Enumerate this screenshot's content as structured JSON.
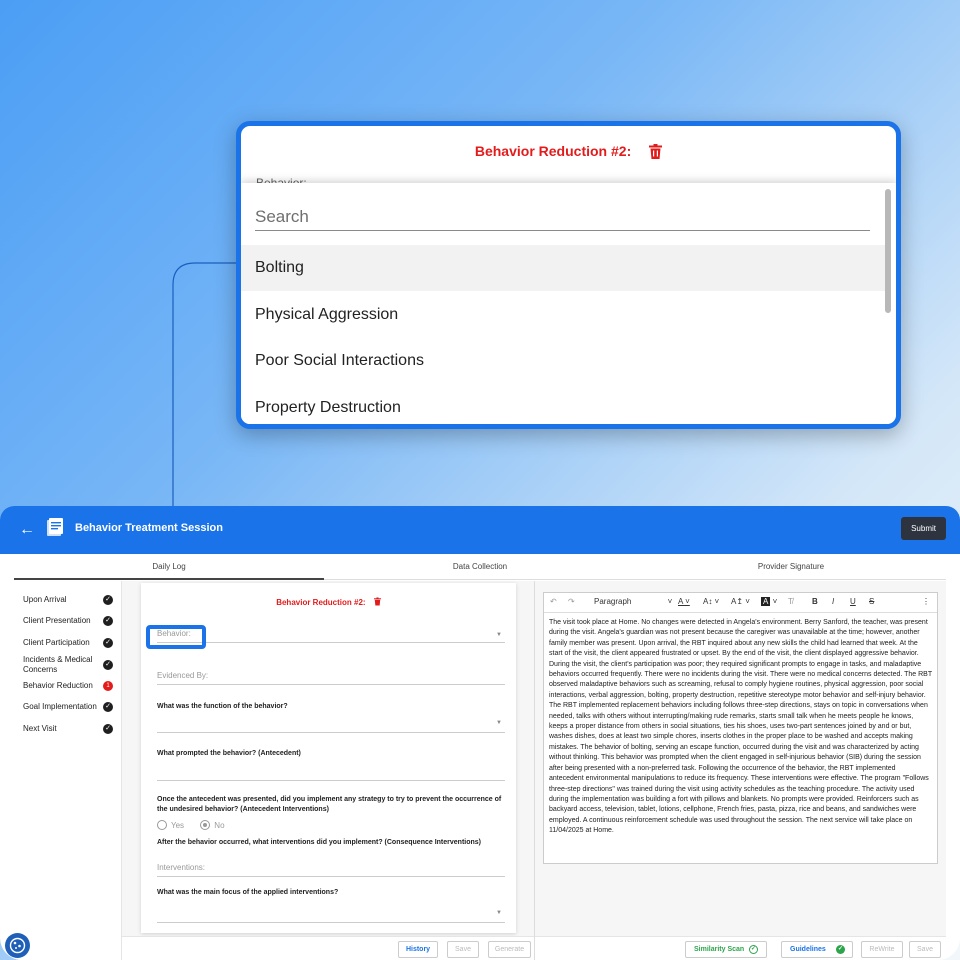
{
  "zoom": {
    "title": "Behavior Reduction #2:",
    "behavior_label": "Behavior:",
    "search_placeholder": "Search",
    "options": [
      "Bolting",
      "Physical Aggression",
      "Poor Social Interactions",
      "Property Destruction"
    ],
    "highlighted_option": "Bolting"
  },
  "app": {
    "title": "Behavior Treatment Session",
    "submit_label": "Submit",
    "tabs": [
      "Daily Log",
      "Data Collection",
      "Provider Signature"
    ],
    "active_tab": "Daily Log",
    "sidebar": [
      {
        "label": "Upon Arrival",
        "status": "check"
      },
      {
        "label": "Client Presentation",
        "status": "check"
      },
      {
        "label": "Client Participation",
        "status": "check"
      },
      {
        "label": "Incidents & Medical Concerns",
        "status": "check"
      },
      {
        "label": "Behavior Reduction",
        "status": "1"
      },
      {
        "label": "Goal Implementation",
        "status": "check"
      },
      {
        "label": "Next Visit",
        "status": "check"
      }
    ],
    "form": {
      "title": "Behavior Reduction #2:",
      "behavior_placeholder": "Behavior:",
      "evidenced_by_placeholder": "Evidenced By:",
      "q_function": "What was the function of the behavior?",
      "q_antecedent": "What prompted the behavior? (Antecedent)",
      "q_strategy": "Once the antecedent was presented, did you implement any strategy to try to prevent the occurrence of the undesired behavior? (Antecedent Interventions)",
      "radio_yes": "Yes",
      "radio_no": "No",
      "radio_selected": "No",
      "q_consequence": "After the behavior occurred, what interventions did you implement? (Consequence Interventions)",
      "interventions_placeholder": "Interventions:",
      "q_focus": "What was the main focus of the applied interventions?"
    },
    "left_footer": {
      "history": "History",
      "save": "Save",
      "generate": "Generate"
    },
    "editor": {
      "paragraph_style": "Paragraph",
      "text": "The visit took place at Home. No changes were detected in Angela's environment. Berry Sanford, the teacher, was present during the visit. Angela's guardian was not present because the caregiver was unavailable at the time; however, another family member was present. Upon arrival, the RBT inquired about any new skills the child had learned that week. At the start of the visit, the client appeared frustrated or upset. By the end of the visit, the client displayed aggressive behavior. During the visit, the client's participation was poor; they required significant prompts to engage in tasks, and maladaptive behaviors occurred frequently. There were no incidents during the visit. There were no medical concerns detected. The RBT observed maladaptive behaviors such as screaming, refusal to comply hygiene routines, physical aggression, poor social interactions, verbal aggression, bolting, property destruction, repetitive stereotype motor behavior and self-injury behavior. The RBT implemented replacement behaviors including follows three-step directions, stays on topic in conversations when needed, talks with others without interrupting/making rude remarks, starts small talk when he meets people he knows, keeps a proper distance from others in social situations, ties his shoes, uses two-part sentences joined by and or but, washes dishes, does at least two simple chores, inserts clothes in the proper place to be washed and accepts making mistakes. The behavior of bolting, serving an escape function, occurred during the visit and was characterized by acting without thinking. This behavior was prompted when the client engaged in self-injurious behavior (SIB) during the session after being presented with a non-preferred task. Following the occurrence of the behavior, the RBT implemented antecedent environmental manipulations to reduce its frequency. These interventions were effective. The program \"Follows three-step directions\" was trained during the visit using activity schedules as the teaching procedure. The activity used during the implementation was building a fort with pillows and blankets. No prompts were provided. Reinforcers such as backyard access, television, tablet, lotions, cellphone, French fries, pasta, pizza, rice and beans, and sandwiches were employed. A continuous reinforcement schedule was used throughout the session. The next service will take place on 11/04/2025 at Home."
    },
    "right_footer": {
      "similarity": "Similarity Scan",
      "guidelines": "Guidelines",
      "rewrite": "ReWrite",
      "save": "Save"
    }
  },
  "colors": {
    "accent": "#1a73e8",
    "alert_red": "#e31b1b",
    "success_green": "#2ca44a"
  }
}
